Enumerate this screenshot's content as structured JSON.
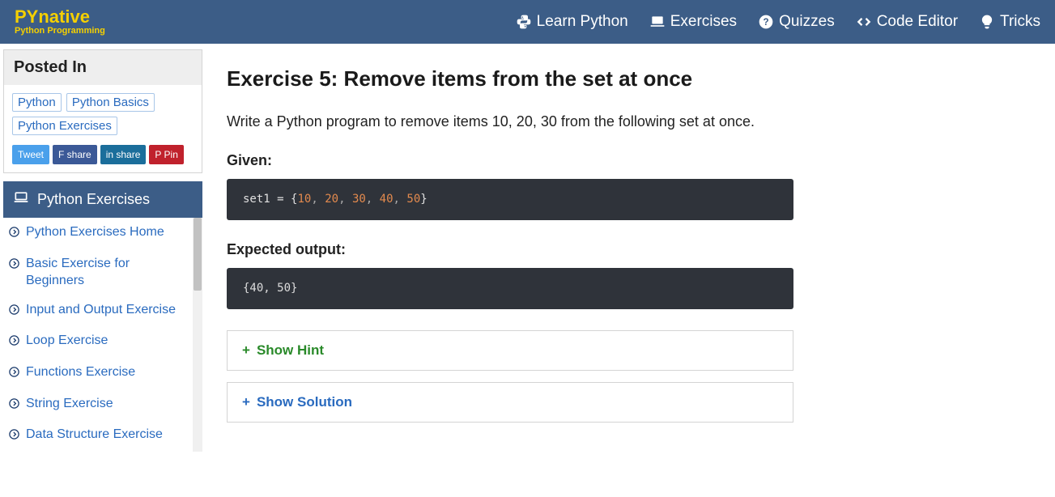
{
  "header": {
    "logo_main": "PYnative",
    "logo_sub": "Python Programming",
    "nav": {
      "learn": "Learn Python",
      "exercises": "Exercises",
      "quizzes": "Quizzes",
      "editor": "Code Editor",
      "tricks": "Tricks"
    }
  },
  "posted": {
    "title": "Posted In",
    "tags": [
      "Python",
      "Python Basics",
      "Python Exercises"
    ],
    "share": {
      "tweet": "Tweet",
      "fb": "F  share",
      "li": "in  share",
      "pin": "P  Pin"
    }
  },
  "sidebar": {
    "title": "Python Exercises",
    "items": [
      "Python Exercises Home",
      "Basic Exercise for Beginners",
      "Input and Output Exercise",
      "Loop Exercise",
      "Functions Exercise",
      "String Exercise",
      "Data Structure Exercise"
    ]
  },
  "content": {
    "title": "Exercise 5: Remove items from the set at once",
    "description": "Write a Python program to remove items 10, 20, 30 from the following set at once.",
    "given_label": "Given",
    "given_code_raw": "set1 = {10, 20, 30, 40, 50}",
    "expected_label": "Expected output:",
    "expected_code": "{40, 50}",
    "hint_label": "Show Hint",
    "solution_label": "Show Solution"
  }
}
